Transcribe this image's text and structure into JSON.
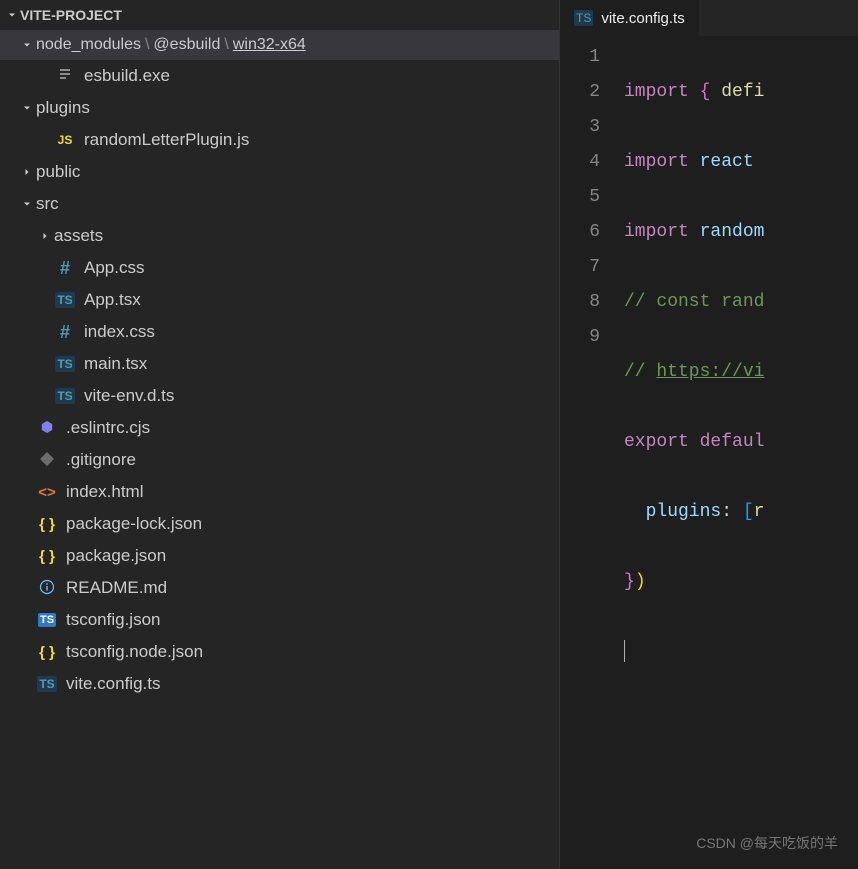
{
  "project": {
    "name": "VITE-PROJECT"
  },
  "breadcrumb": {
    "seg1": "node_modules",
    "seg2": "@esbuild",
    "seg3": "win32-x64",
    "sep": "\\"
  },
  "tree": [
    {
      "depth": 1,
      "arrow": "",
      "iconType": "lines",
      "label": "esbuild.exe"
    },
    {
      "depth": 0,
      "arrow": "down",
      "iconType": "",
      "label": "plugins"
    },
    {
      "depth": 1,
      "arrow": "",
      "iconType": "js",
      "label": "randomLetterPlugin.js"
    },
    {
      "depth": 0,
      "arrow": "right",
      "iconType": "",
      "label": "public"
    },
    {
      "depth": 0,
      "arrow": "down",
      "iconType": "",
      "label": "src"
    },
    {
      "depth": 1,
      "arrow": "right",
      "iconType": "",
      "label": "assets"
    },
    {
      "depth": 1,
      "arrow": "",
      "iconType": "hash",
      "label": "App.css"
    },
    {
      "depth": 1,
      "arrow": "",
      "iconType": "ts",
      "label": "App.tsx"
    },
    {
      "depth": 1,
      "arrow": "",
      "iconType": "hash",
      "label": "index.css"
    },
    {
      "depth": 1,
      "arrow": "",
      "iconType": "ts",
      "label": "main.tsx"
    },
    {
      "depth": 1,
      "arrow": "",
      "iconType": "ts",
      "label": "vite-env.d.ts"
    },
    {
      "depth": 0,
      "arrow": "",
      "iconType": "eslint",
      "label": ".eslintrc.cjs"
    },
    {
      "depth": 0,
      "arrow": "",
      "iconType": "git",
      "label": ".gitignore"
    },
    {
      "depth": 0,
      "arrow": "",
      "iconType": "html",
      "label": "index.html"
    },
    {
      "depth": 0,
      "arrow": "",
      "iconType": "curly",
      "label": "package-lock.json"
    },
    {
      "depth": 0,
      "arrow": "",
      "iconType": "curly",
      "label": "package.json"
    },
    {
      "depth": 0,
      "arrow": "",
      "iconType": "info",
      "label": "README.md"
    },
    {
      "depth": 0,
      "arrow": "",
      "iconType": "tsb",
      "label": "tsconfig.json"
    },
    {
      "depth": 0,
      "arrow": "",
      "iconType": "curly",
      "label": "tsconfig.node.json"
    },
    {
      "depth": 0,
      "arrow": "",
      "iconType": "ts",
      "label": "vite.config.ts"
    }
  ],
  "tab": {
    "icon": "TS",
    "label": "vite.config.ts"
  },
  "lines": {
    "n1": "1",
    "n2": "2",
    "n3": "3",
    "n4": "4",
    "n5": "5",
    "n6": "6",
    "n7": "7",
    "n8": "8",
    "n9": "9"
  },
  "code": {
    "l1_import": "import",
    "l1_brace": "{",
    "l1_defi": "defi",
    "l2_import": "import",
    "l2_react": "react",
    "l3_import": "import",
    "l3_random": "random",
    "l4": "// const rand",
    "l5_pre": "// ",
    "l5_link": "https://vi",
    "l6_export": "export",
    "l6_default": "defaul",
    "l7_plugins": "plugins",
    "l7_colon": ":",
    "l7_br": "[",
    "l7_r": "r",
    "l8_close": "}",
    "l8_paren": ")"
  },
  "watermark": "CSDN @每天吃饭的羊"
}
